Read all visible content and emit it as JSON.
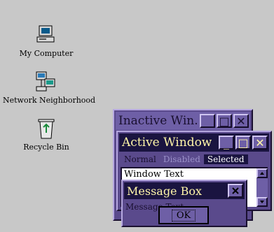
{
  "desktop": {
    "icons": [
      {
        "label": "My Computer",
        "icon": "computer-icon"
      },
      {
        "label": "Network Neighborhood",
        "icon": "network-icon"
      },
      {
        "label": "Recycle Bin",
        "icon": "recycle-bin-icon"
      }
    ]
  },
  "inactive_window": {
    "title": "Inactive Win...",
    "buttons": [
      "_",
      "□",
      "✕"
    ]
  },
  "active_window": {
    "title": "Active Window",
    "buttons": [
      "_",
      "□",
      "✕"
    ],
    "menu": {
      "normal": "Normal",
      "disabled": "Disabled",
      "selected": "Selected"
    },
    "window_text": "Window Text"
  },
  "message_box": {
    "title": "Message Box",
    "text": "Message Text",
    "ok_label": "OK"
  },
  "colors": {
    "desktop": "#c8c8c8",
    "window_frame": "#5a4a8c",
    "active_title": "#1a1440",
    "active_title_text": "#fff6a8",
    "inactive_title": "#6e5fa6"
  }
}
